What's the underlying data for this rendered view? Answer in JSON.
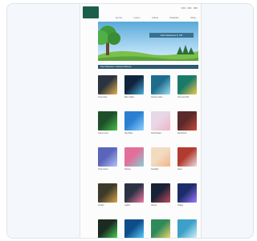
{
  "header": {
    "logo_text": "",
    "phone": "000 · 000 · 000",
    "nav": [
      "Home",
      "Listen",
      "Artists",
      "Playlists",
      "Shop"
    ]
  },
  "hero": {
    "banner_text": "New Releases in CD"
  },
  "section": {
    "title": "New Releases / Featured Albums"
  },
  "albums": [
    {
      "caption": "Cool Jazz",
      "colors": [
        "#2a3340",
        "#e8b24a"
      ]
    },
    {
      "caption": "Blue Night",
      "colors": [
        "#10243e",
        "#4bb3e0"
      ]
    },
    {
      "caption": "Ocean Calm",
      "colors": [
        "#1f6b8c",
        "#9be0f0"
      ]
    },
    {
      "caption": "Summer Mix",
      "colors": [
        "#1a7a6a",
        "#f1c94a"
      ]
    },
    {
      "caption": "Green Line",
      "colors": [
        "#1e4f2a",
        "#48c048"
      ]
    },
    {
      "caption": "Sky Blue",
      "colors": [
        "#2b7fd2",
        "#8fd2ff"
      ]
    },
    {
      "caption": "Soft Pastel",
      "colors": [
        "#e8d7e6",
        "#f0b3c7"
      ]
    },
    {
      "caption": "Red Rock",
      "colors": [
        "#5a2a2a",
        "#c44a3a"
      ]
    },
    {
      "caption": "Violet Hour",
      "colors": [
        "#5a64b8",
        "#b7c1ff"
      ]
    },
    {
      "caption": "Spring",
      "colors": [
        "#e26f9a",
        "#84d1d4"
      ]
    },
    {
      "caption": "Sunlight",
      "colors": [
        "#f1dcc2",
        "#f5b38a"
      ]
    },
    {
      "caption": "Heat",
      "colors": [
        "#b23a2f",
        "#e7e1e1"
      ]
    },
    {
      "caption": "Amber",
      "colors": [
        "#3c3a2a",
        "#d9a24a"
      ]
    },
    {
      "caption": "Lights",
      "colors": [
        "#2b3244",
        "#f07aa4"
      ]
    },
    {
      "caption": "Abyss",
      "colors": [
        "#162235",
        "#c14b5b"
      ]
    },
    {
      "caption": "Indigo",
      "colors": [
        "#1e2b6b",
        "#9b7cff"
      ]
    },
    {
      "caption": "Neon Green",
      "colors": [
        "#1c2b22",
        "#46d65a"
      ]
    },
    {
      "caption": "Blue Stage",
      "colors": [
        "#0f4c8a",
        "#5bd0ff"
      ]
    },
    {
      "caption": "Tropic",
      "colors": [
        "#2f8a5a",
        "#f5d86a"
      ]
    },
    {
      "caption": "Icy",
      "colors": [
        "#3ca0c8",
        "#d5f5ff"
      ]
    }
  ],
  "colors": {
    "logo_bg": "#1d5e4a",
    "section_bar": "#2f5a6f",
    "banner": "#3a6f8f"
  }
}
